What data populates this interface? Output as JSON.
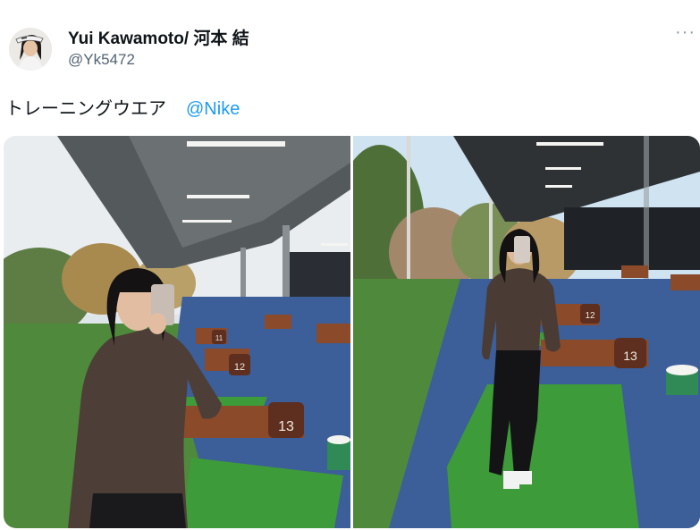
{
  "author": {
    "display_name": "Yui Kawamoto/ 河本 結",
    "handle": "@Yk5472"
  },
  "tweet": {
    "text": "トレーニングウエア",
    "mention": "@Nike",
    "more_icon": "more-horizontal-icon"
  },
  "photos": [
    {
      "tee_numbers": [
        "11",
        "12",
        "13"
      ]
    },
    {
      "tee_numbers": [
        "12",
        "13"
      ]
    }
  ]
}
